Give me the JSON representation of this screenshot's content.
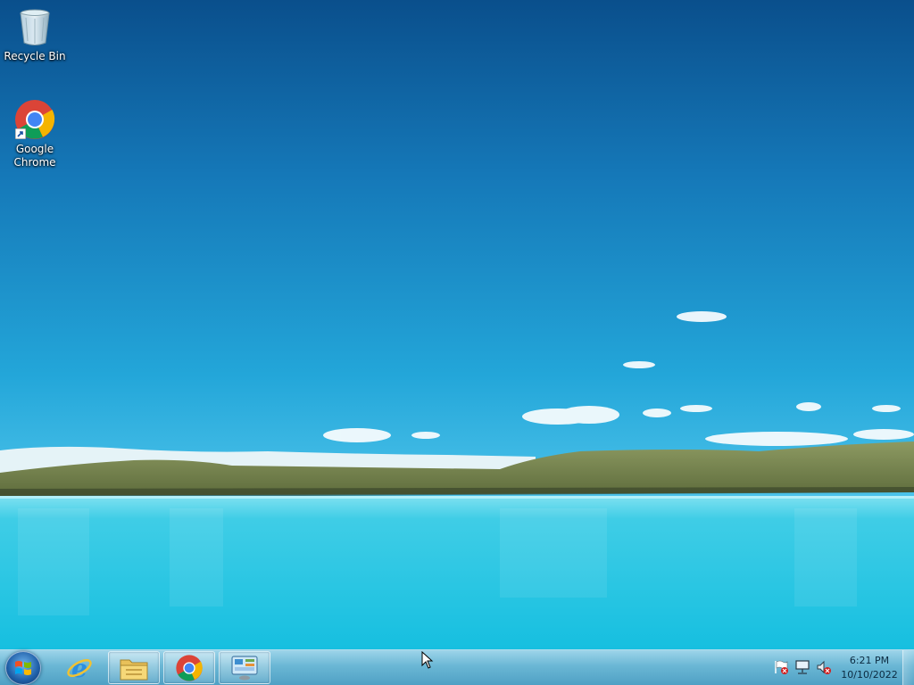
{
  "desktop": {
    "icons": [
      {
        "label": "Recycle Bin",
        "icon": "recycle-bin-icon"
      },
      {
        "label": "Google Chrome",
        "icon": "chrome-icon"
      }
    ]
  },
  "taskbar": {
    "start": {
      "icon": "windows-logo-icon"
    },
    "pinned": [
      {
        "name": "Internet Explorer",
        "icon": "internet-explorer-icon"
      },
      {
        "name": "Windows Explorer",
        "icon": "file-explorer-icon"
      },
      {
        "name": "Google Chrome",
        "icon": "chrome-icon"
      },
      {
        "name": "Control Panel",
        "icon": "control-panel-icon"
      }
    ],
    "tray": {
      "icons": [
        "action-center-flag-icon",
        "network-icon",
        "volume-muted-icon"
      ],
      "time": "6:21 PM",
      "date": "10/10/2022"
    }
  },
  "colors": {
    "sky_top": "#0a4f8c",
    "sky_mid": "#1d9fd6",
    "lake": "#1cc3e2",
    "hills": "#7a8a4e"
  }
}
